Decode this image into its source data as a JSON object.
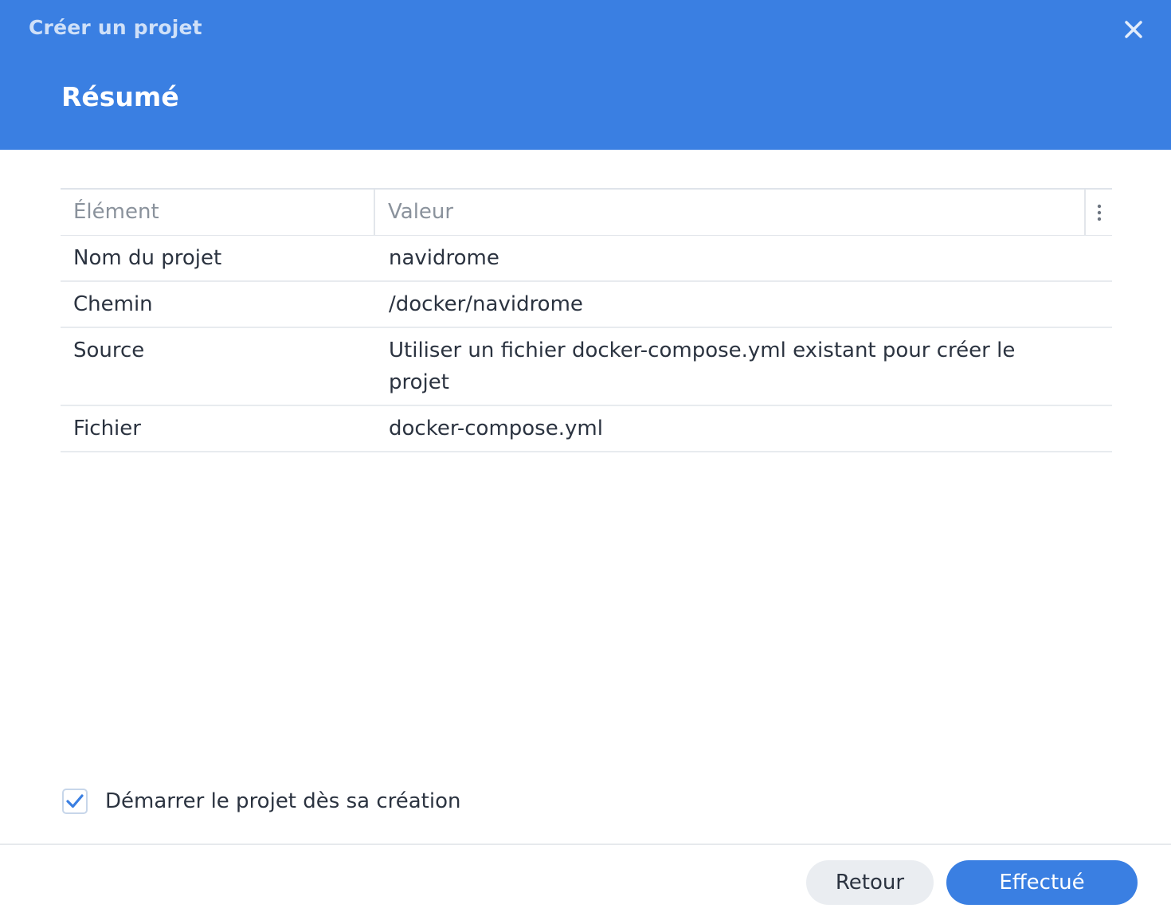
{
  "dialog": {
    "window_title": "Créer un projet",
    "step_title": "Résumé",
    "close_icon": "close-icon"
  },
  "table": {
    "columns": [
      "Élément",
      "Valeur"
    ],
    "menu_icon": "vertical-dots-icon",
    "rows": [
      {
        "item": "Nom du projet",
        "value": "navidrome"
      },
      {
        "item": "Chemin",
        "value": "/docker/navidrome"
      },
      {
        "item": "Source",
        "value": "Utiliser un fichier docker-compose.yml existant pour créer le projet"
      },
      {
        "item": "Fichier",
        "value": "docker-compose.yml"
      }
    ]
  },
  "options": {
    "start_on_create_label": "Démarrer le projet dès sa création",
    "start_on_create_checked": true
  },
  "footer": {
    "back_label": "Retour",
    "done_label": "Effectué"
  },
  "colors": {
    "accent": "#3a7fe2",
    "header_title": "#cfe0f8",
    "text": "#2b3340",
    "muted": "#8a929c"
  }
}
